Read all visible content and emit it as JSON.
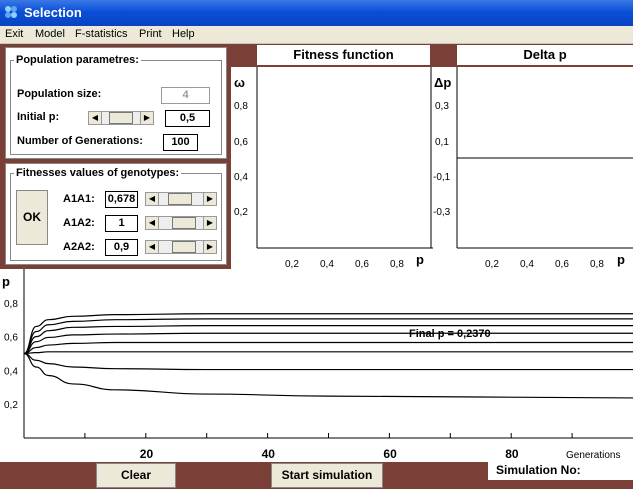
{
  "window": {
    "title": "Selection"
  },
  "menu": [
    "Exit",
    "Model",
    "F-statistics",
    "Print",
    "Help"
  ],
  "population": {
    "group_title": "Population parametres:",
    "size_label": "Population size:",
    "size_value": "4",
    "initial_p_label": "Initial p:",
    "initial_p_value": "0,5",
    "initial_p_fraction": 0.5,
    "generations_label": "Number of Generations:",
    "generations_value": "100"
  },
  "fitness": {
    "group_title": "Fitnesses values of genotypes:",
    "ok_label": "OK",
    "genotypes": [
      {
        "label": "A1A1:",
        "value": "0,678",
        "fraction": 0.45
      },
      {
        "label": "A1A2:",
        "value": "1",
        "fraction": 0.62
      },
      {
        "label": "A2A2:",
        "value": "0,9",
        "fraction": 0.62
      }
    ]
  },
  "fitness_plot": {
    "title": "Fitness function",
    "ylabel": "ω",
    "xlabel": "p",
    "yticks": [
      "0,8",
      "0,6",
      "0,4",
      "0,2"
    ],
    "xticks": [
      "0,2",
      "0,4",
      "0,6",
      "0,8"
    ]
  },
  "delta_plot": {
    "title": "Delta p",
    "ylabel": "Δp",
    "xlabel": "p",
    "yticks": [
      "0,3",
      "0,1",
      "-0,1",
      "-0,3"
    ],
    "xticks": [
      "0,2",
      "0,4",
      "0,6",
      "0,8"
    ]
  },
  "chart_data": {
    "type": "line",
    "ylabel": "p",
    "xlabel": "Generations",
    "xlim": [
      0,
      100
    ],
    "ylim": [
      0,
      1
    ],
    "xticks": [
      "20",
      "40",
      "60",
      "80"
    ],
    "yticks": [
      "0,8",
      "0,6",
      "0,4",
      "0,2"
    ],
    "annotation": "Final p = 0,2370",
    "series": [
      {
        "x": [
          0,
          2,
          4,
          8,
          15,
          30,
          50,
          100
        ],
        "y": [
          0.5,
          0.66,
          0.7,
          0.72,
          0.73,
          0.735,
          0.735,
          0.735
        ]
      },
      {
        "x": [
          0,
          2,
          4,
          8,
          15,
          30,
          50,
          100
        ],
        "y": [
          0.5,
          0.63,
          0.67,
          0.69,
          0.7,
          0.705,
          0.705,
          0.705
        ]
      },
      {
        "x": [
          0,
          2,
          4,
          8,
          15,
          30,
          50,
          100
        ],
        "y": [
          0.5,
          0.6,
          0.635,
          0.655,
          0.66,
          0.665,
          0.665,
          0.665
        ]
      },
      {
        "x": [
          0,
          2,
          4,
          8,
          15,
          30,
          50,
          100
        ],
        "y": [
          0.5,
          0.57,
          0.595,
          0.61,
          0.615,
          0.62,
          0.62,
          0.62
        ]
      },
      {
        "x": [
          0,
          2,
          4,
          8,
          15,
          30,
          50,
          100
        ],
        "y": [
          0.5,
          0.535,
          0.55,
          0.56,
          0.565,
          0.565,
          0.565,
          0.565
        ]
      },
      {
        "x": [
          0,
          2,
          4,
          8,
          15,
          30,
          50,
          100
        ],
        "y": [
          0.5,
          0.505,
          0.51,
          0.51,
          0.51,
          0.51,
          0.51,
          0.51
        ]
      },
      {
        "x": [
          0,
          2,
          4,
          8,
          15,
          30,
          50,
          100
        ],
        "y": [
          0.5,
          0.46,
          0.44,
          0.42,
          0.41,
          0.405,
          0.405,
          0.405
        ]
      },
      {
        "x": [
          0,
          2,
          4,
          8,
          15,
          30,
          50,
          100
        ],
        "y": [
          0.5,
          0.42,
          0.37,
          0.32,
          0.285,
          0.26,
          0.248,
          0.237
        ]
      }
    ]
  },
  "buttons": {
    "clear": "Clear",
    "start": "Start simulation"
  },
  "status": {
    "simulation_label": "Simulation No:"
  }
}
